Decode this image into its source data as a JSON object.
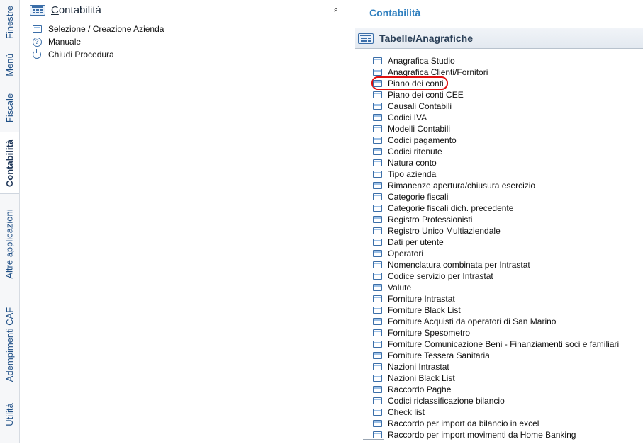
{
  "sidebar": {
    "tabs": [
      {
        "label": "Finestre",
        "active": false
      },
      {
        "label": "Menù",
        "active": false
      },
      {
        "label": "Fiscale",
        "active": false
      },
      {
        "label": "Contabilità",
        "active": true
      },
      {
        "label": "Altre applicazioni",
        "active": false
      },
      {
        "label": "Adempimenti CAF",
        "active": false
      },
      {
        "label": "Utilità",
        "active": false
      }
    ]
  },
  "left_panel": {
    "title": "Contabilità",
    "collapse_glyph": "»",
    "items": [
      {
        "label": "Selezione / Creazione Azienda",
        "icon": "document-icon"
      },
      {
        "label": "Manuale",
        "icon": "help-icon"
      },
      {
        "label": "Chiudi Procedura",
        "icon": "power-icon"
      }
    ]
  },
  "right_panel": {
    "title": "Contabilità",
    "section_label": "Tabelle/Anagrafiche",
    "highlighted_item": "Piano dei conti",
    "items": [
      "Anagrafica Studio",
      "Anagrafica Clienti/Fornitori",
      "Piano dei conti",
      "Piano dei conti CEE",
      "Causali Contabili",
      "Codici IVA",
      "Modelli Contabili",
      "Codici pagamento",
      "Codici ritenute",
      "Natura conto",
      "Tipo azienda",
      "Rimanenze apertura/chiusura esercizio",
      "Categorie fiscali",
      "Categorie fiscali dich. precedente",
      "Registro Professionisti",
      "Registro Unico Multiaziendale",
      "Dati per utente",
      "Operatori",
      "Nomenclatura combinata per Intrastat",
      "Codice servizio per Intrastat",
      "Valute",
      "Forniture Intrastat",
      "Forniture Black List",
      "Forniture Acquisti da operatori di San Marino",
      "Forniture Spesometro",
      "Forniture Comunicazione Beni - Finanziamenti soci e familiari",
      "Forniture Tessera Sanitaria",
      "Nazioni Intrastat",
      "Nazioni Black List",
      "Raccordo Paghe",
      "Codici riclassificazione bilancio",
      "Check list",
      "Raccordo per import da bilancio in excel",
      "Raccordo per import movimenti da Home Banking"
    ]
  },
  "colors": {
    "accent": "#2f7fbf",
    "tab_text": "#1f4f86",
    "highlight_ring": "#e01010"
  }
}
